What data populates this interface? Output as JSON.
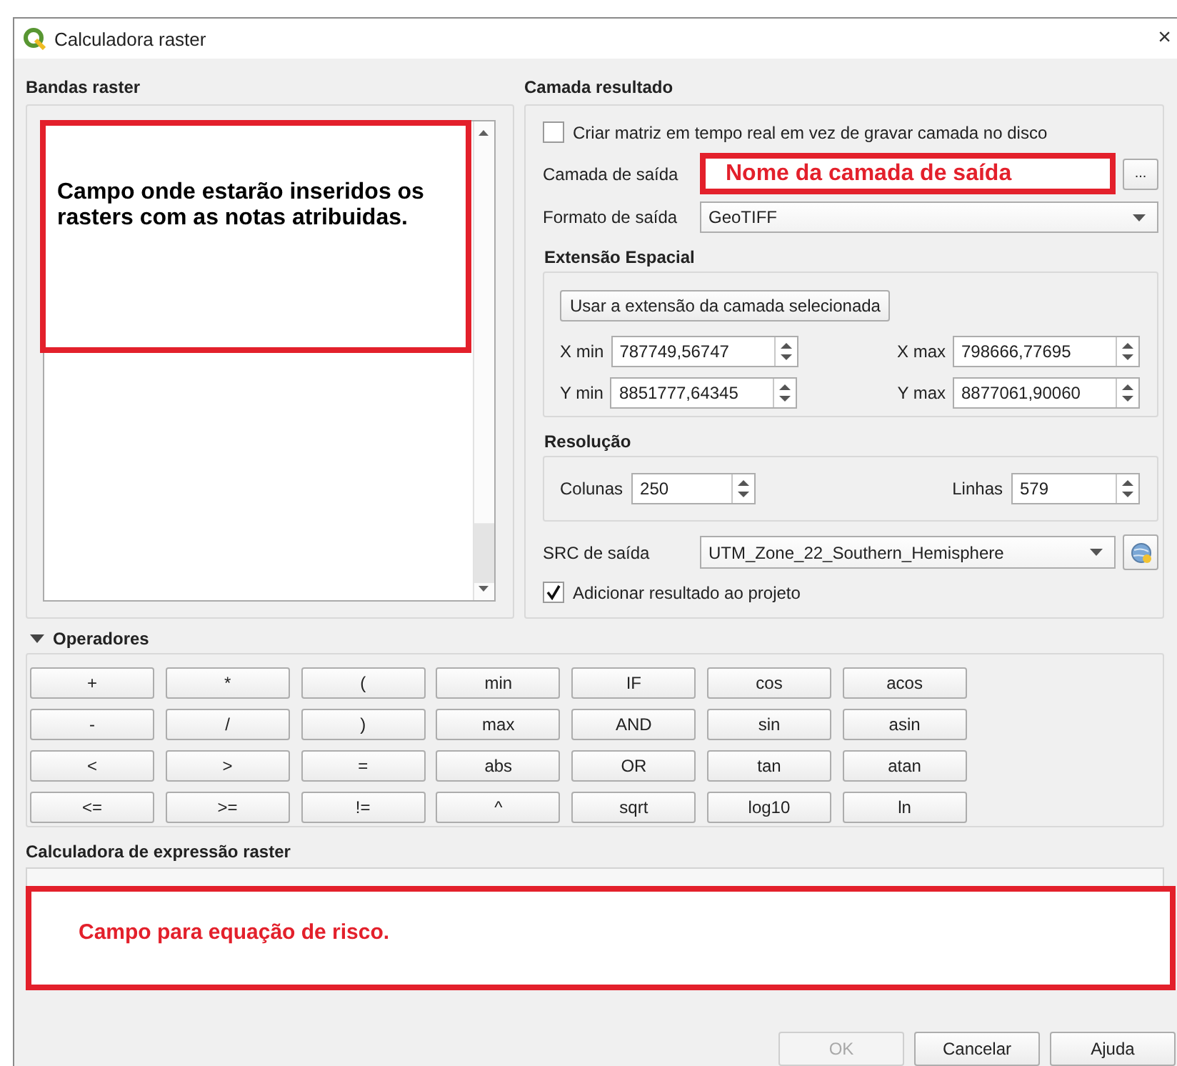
{
  "window": {
    "title": "Calculadora raster",
    "close": "×"
  },
  "raster_bands": {
    "label": "Bandas raster",
    "annotation": "Campo onde estarão inseridos os rasters com as notas atribuidas."
  },
  "result_layer": {
    "label": "Camada resultado",
    "on_the_fly": {
      "label": "Criar matriz em tempo real em vez de gravar camada no disco",
      "checked": false
    },
    "output_layer": {
      "label": "Camada de saída",
      "annotation": "Nome da camada de saída",
      "browse": "..."
    },
    "output_format": {
      "label": "Formato de saída",
      "value": "GeoTIFF"
    },
    "extent": {
      "label": "Extensão Espacial",
      "button": "Usar a extensão da camada selecionada",
      "fields": [
        {
          "label": "X min",
          "value": "787749,56747"
        },
        {
          "label": "X max",
          "value": "798666,77695"
        },
        {
          "label": "Y min",
          "value": "8851777,64345"
        },
        {
          "label": "Y max",
          "value": "8877061,90060"
        }
      ]
    },
    "resolution": {
      "label": "Resolução",
      "fields": [
        {
          "label": "Colunas",
          "value": "250"
        },
        {
          "label": "Linhas",
          "value": "579"
        }
      ]
    },
    "output_crs": {
      "label": "SRC de saída",
      "value": "UTM_Zone_22_Southern_Hemisphere"
    },
    "add_to_project": {
      "label": "Adicionar resultado ao projeto",
      "checked": true
    }
  },
  "operators": {
    "label": "Operadores",
    "expanded": true,
    "buttons": [
      "+",
      "*",
      "(",
      "min",
      "IF",
      "cos",
      "acos",
      "-",
      "/",
      ")",
      "max",
      "AND",
      "sin",
      "asin",
      "<",
      ">",
      "=",
      "abs",
      "OR",
      "tan",
      "atan",
      "<=",
      ">=",
      "!=",
      "^",
      "sqrt",
      "log10",
      "ln"
    ]
  },
  "expression": {
    "label": "Calculadora de expressão raster",
    "annotation": "Campo para equação de risco."
  },
  "buttons": [
    {
      "label": "OK",
      "disabled": true
    },
    {
      "label": "Cancelar",
      "disabled": false
    },
    {
      "label": "Ajuda",
      "disabled": false
    }
  ]
}
